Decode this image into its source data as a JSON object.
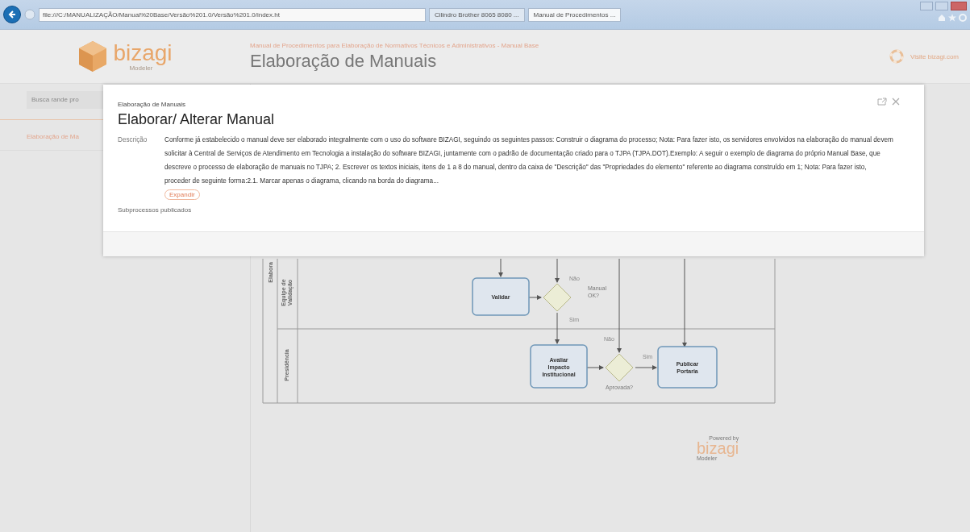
{
  "browser": {
    "address": "file:///C:/MANUALIZAÇÃO/Manual%20Base/Versão%201.0/Versão%201.0/index.ht",
    "tabs": [
      {
        "label": "Cilindro Brother 8065 8080 ...",
        "selected": false
      },
      {
        "label": "Manual de Procedimentos ...",
        "selected": true
      }
    ]
  },
  "header": {
    "logo_text": "bizagi",
    "logo_sub": "Modeler",
    "subtitle": "Manual de Procedimentos para Elaboração de Normativos Técnicos e Administrativos - Manual Base",
    "title": "Elaboração de Manuais",
    "visit_link": "Visite bizagi.com"
  },
  "sidebar": {
    "search_placeholder": "Busca rande pro",
    "menu_items": [
      {
        "label": "Elaboração de Ma",
        "selected": true
      }
    ]
  },
  "diagram": {
    "pool_label": "Elabora",
    "lanes": [
      {
        "label_lines": [
          "Equipe de",
          "Validação"
        ]
      },
      {
        "label_lines": [
          "Presidência"
        ]
      }
    ],
    "tasks": [
      {
        "label_lines": [
          "Validar"
        ]
      },
      {
        "label_lines": [
          "Avaliar",
          "Impacto",
          "Institucional"
        ]
      },
      {
        "label_lines": [
          "Publicar",
          "Portaria"
        ]
      }
    ],
    "gateways": [
      {
        "label_lines": [
          "Manual",
          "OK?"
        ]
      },
      {
        "label_lines": [
          "Aprovada?"
        ]
      }
    ],
    "flow_labels": [
      "Não",
      "Sim",
      "Não",
      "Sim"
    ]
  },
  "footer_logo": {
    "powered": "Powered by",
    "name": "bizagi",
    "sub": "Modeler"
  },
  "modal": {
    "breadcrumb": "Elaboração de Manuais",
    "title": "Elaborar/ Alterar Manual",
    "description_label": "Descrição",
    "description": "Conforme já estabelecido o manual deve ser elaborado integralmente com o uso do software BIZAGI, seguindo os seguintes passos:  Construir o diagrama do processo; Nota: Para fazer isto, os servidores envolvidos na elaboração do manual devem solicitar à Central de Serviços de Atendimento em Tecnologia a instalação do software BIZAGI, juntamente com o padrão de documentação criado para o TJPA (TJPA.DOT).Exemplo: A seguir o exemplo de diagrama do próprio Manual Base, que descreve o processo de elaboração de manuais no TJPA; 2. Escrever os textos iniciais, itens de 1 a 8 do manual, dentro da caixa de \"Descrição\" das \"Propriedades do elemento\" referente ao diagrama construído em 1; Nota: Para fazer isto, proceder de seguinte forma:2.1. Marcar apenas o diagrama, clicando na borda do diagrama...",
    "expand_button": "Expandir",
    "subprocess_label": "Subprocessos publicados"
  }
}
